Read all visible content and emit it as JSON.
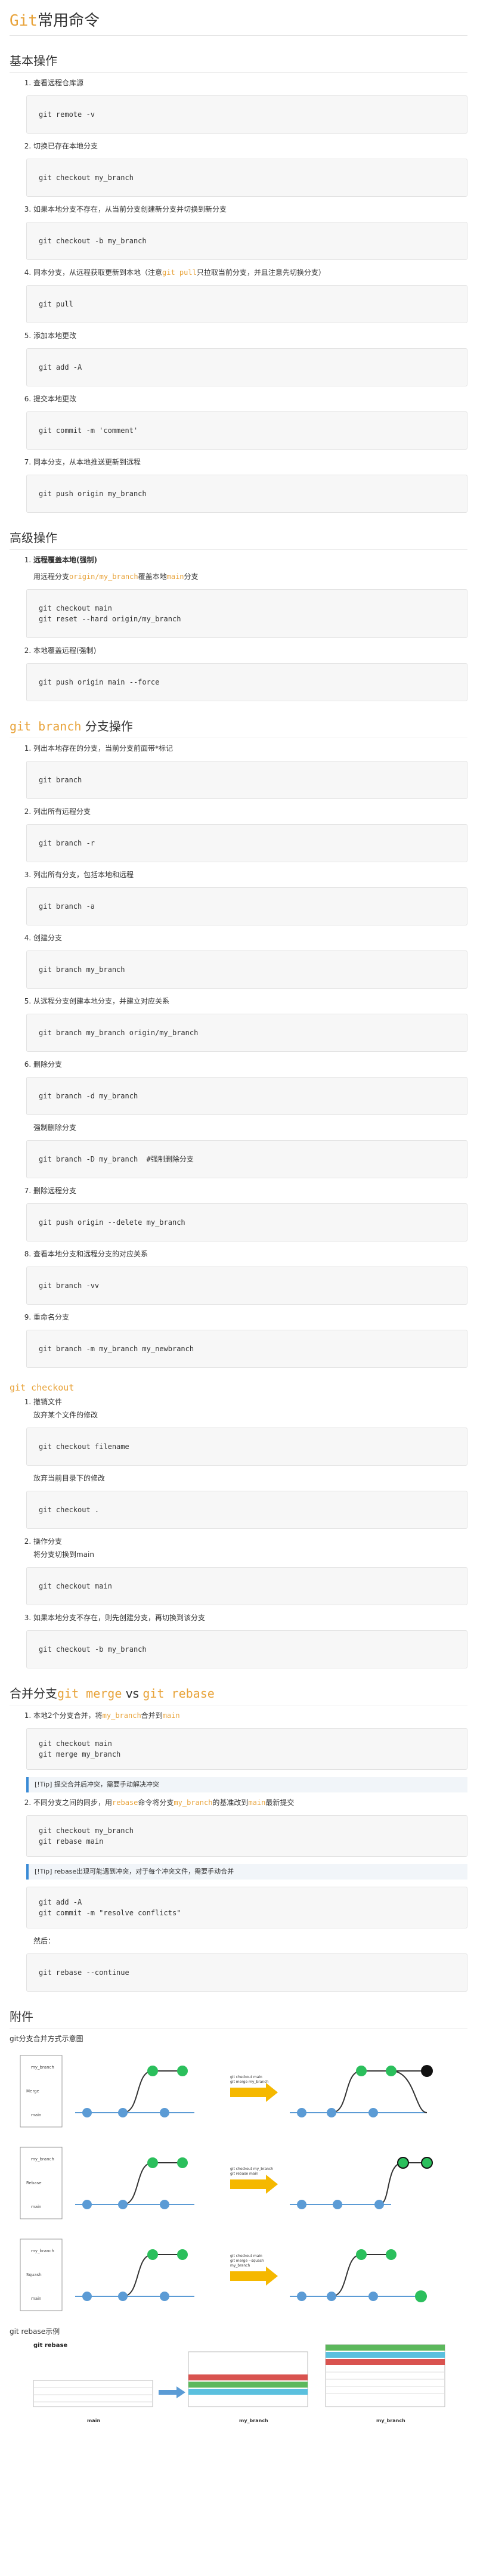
{
  "title": {
    "prefix": "Git",
    "rest": "常用命令"
  },
  "basic": {
    "heading": "基本操作",
    "items": [
      {
        "label": "查看远程仓库源",
        "code": "git remote -v"
      },
      {
        "label": "切换已存在本地分支",
        "code": "git checkout my_branch"
      },
      {
        "label": "如果本地分支不存在，从当前分支创建新分支并切换到新分支",
        "code": "git checkout -b my_branch"
      },
      {
        "label_a": "同本分支，从远程获取更新到本地（注意",
        "label_code": "git pull",
        "label_b": "只拉取当前分支，并且注意先切换分支）",
        "code": "git pull"
      },
      {
        "label": "添加本地更改",
        "code": "git add -A"
      },
      {
        "label": "提交本地更改",
        "code": "git commit -m 'comment'"
      },
      {
        "label": "同本分支，从本地推送更新到远程",
        "code": "git push origin my_branch"
      }
    ]
  },
  "advanced": {
    "heading": "高级操作",
    "items": [
      {
        "label": "远程覆盖本地(强制)",
        "note_a": "用远程分支",
        "note_code1": "origin/my_branch",
        "note_b": "覆盖本地",
        "note_code2": "main",
        "note_c": "分支",
        "code": "git checkout main\ngit reset --hard origin/my_branch"
      },
      {
        "label": "本地覆盖远程(强制)",
        "code": "git push origin main --force"
      }
    ]
  },
  "branch": {
    "heading_code": "git branch",
    "heading_text": " 分支操作",
    "items": [
      {
        "label": "列出本地存在的分支，当前分支前面带*标记",
        "code": "git branch"
      },
      {
        "label": "列出所有远程分支",
        "code": "git branch -r"
      },
      {
        "label": "列出所有分支，包括本地和远程",
        "code": "git branch -a"
      },
      {
        "label": "创建分支",
        "code": "git branch my_branch"
      },
      {
        "label": "从远程分支创建本地分支，并建立对应关系",
        "code": "git branch my_branch origin/my_branch"
      },
      {
        "label": "删除分支",
        "code": "git branch -d my_branch",
        "extra_label": "强制删除分支",
        "extra_code": "git branch -D my_branch  #强制删除分支"
      },
      {
        "label": "删除远程分支",
        "code": "git push origin --delete my_branch"
      },
      {
        "label": "查看本地分支和远程分支的对应关系",
        "code": "git branch -vv"
      },
      {
        "label": "重命名分支",
        "code": "git branch -m my_branch my_newbranch"
      }
    ]
  },
  "checkout": {
    "heading": "git checkout",
    "item1": {
      "label": "撤销文件",
      "desc1": "放弃某个文件的修改",
      "code1": "git checkout filename",
      "desc2": "放弃当前目录下的修改",
      "code2": "git checkout ."
    },
    "item2": {
      "label": "操作分支",
      "desc": "将分支切换到main",
      "code": "git checkout main"
    },
    "item3": {
      "label": "如果本地分支不存在，则先创建分支，再切换到该分支",
      "code": "git checkout -b my_branch"
    }
  },
  "merge": {
    "heading_a": "合并分支",
    "heading_code1": "git merge",
    "heading_vs": " vs ",
    "heading_code2": "git rebase",
    "item1": {
      "label_a": "本地2个分支合并，将",
      "label_code1": "my_branch",
      "label_b": "合并到",
      "label_code2": "main",
      "code": "git checkout main\ngit merge my_branch",
      "tip": "[!Tip] 提交合并后冲突，需要手动解决冲突"
    },
    "item2": {
      "label_a": "不同分支之间的同步，用",
      "label_code1": "rebase",
      "label_b": "命令将分支",
      "label_code2": "my_branch",
      "label_c": "的基准改到",
      "label_code3": "main",
      "label_d": "最新提交",
      "code": "git checkout my_branch\ngit rebase main",
      "tip": "[!Tip] rebase出现可能遇到冲突，对于每个冲突文件，需要手动合并",
      "code2": "git add -A\ngit commit -m \"resolve conflicts\"",
      "after": "然后：",
      "code3": "git rebase --continue"
    }
  },
  "appendix": {
    "heading": "附件",
    "caption1": "git分支合并方式示意图",
    "rows": [
      {
        "left_lines": [
          "my_branch",
          "",
          "Merge",
          "",
          "main"
        ],
        "arrow_label": "git checkout main\ngit merge my_branch"
      },
      {
        "left_lines": [
          "my_branch",
          "",
          "Rebase",
          "",
          "main"
        ],
        "arrow_label": "git checkout my_branch\ngit rebase main"
      },
      {
        "left_lines": [
          "my_branch",
          "",
          "Squash",
          "",
          "main"
        ],
        "arrow_label": "git checkout main\ngit merge --squash\nmy_branch"
      }
    ],
    "caption2": "git rebase示例",
    "rebase_title": "git rebase",
    "rebase_cols": [
      "main",
      "my_branch",
      "my_branch"
    ],
    "colors": {
      "accent": "#e8a33a",
      "node_blue": "#5b9bd5",
      "node_green": "#2bbf5c",
      "arrow": "#f5b800",
      "tip_border": "#3a8bd6"
    }
  }
}
